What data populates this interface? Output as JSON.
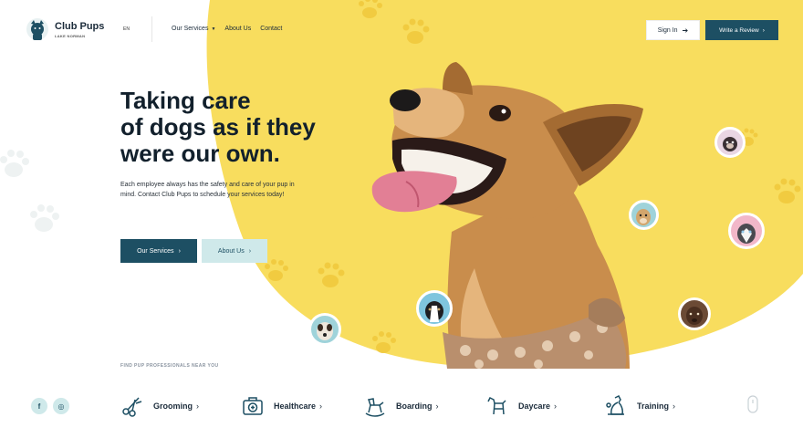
{
  "brand": {
    "name": "Club Pups",
    "location": "LAKE NORMAN"
  },
  "language": "EN",
  "nav": [
    {
      "label": "Our Services",
      "has_dropdown": true
    },
    {
      "label": "About Us",
      "has_dropdown": false
    },
    {
      "label": "Contact",
      "has_dropdown": false
    }
  ],
  "header_actions": {
    "signin_label": "Sign In",
    "review_label": "Write a Review"
  },
  "hero": {
    "headline_lines": [
      "Taking care",
      "of dogs as if they",
      "were our own."
    ],
    "subtext": "Each employee always has the safety and care of your pup in mind. Contact Club Pups to schedule your services today!",
    "primary_button": "Our Services",
    "secondary_button": "About Us"
  },
  "find_label": "FIND PUP PROFESSIONALS NEAR YOU",
  "social": [
    {
      "label": "f",
      "icon": "facebook-icon"
    },
    {
      "label": "◎",
      "icon": "instagram-icon"
    }
  ],
  "services": [
    {
      "label": "Grooming",
      "icon": "scissors-icon"
    },
    {
      "label": "Healthcare",
      "icon": "medical-kit-icon"
    },
    {
      "label": "Boarding",
      "icon": "rocking-horse-icon"
    },
    {
      "label": "Daycare",
      "icon": "dog-icon"
    },
    {
      "label": "Training",
      "icon": "sitting-dog-icon"
    }
  ],
  "colors": {
    "accent": "#1d4f63",
    "yellow": "#f8dd5e",
    "mint": "#cfe9ea"
  }
}
